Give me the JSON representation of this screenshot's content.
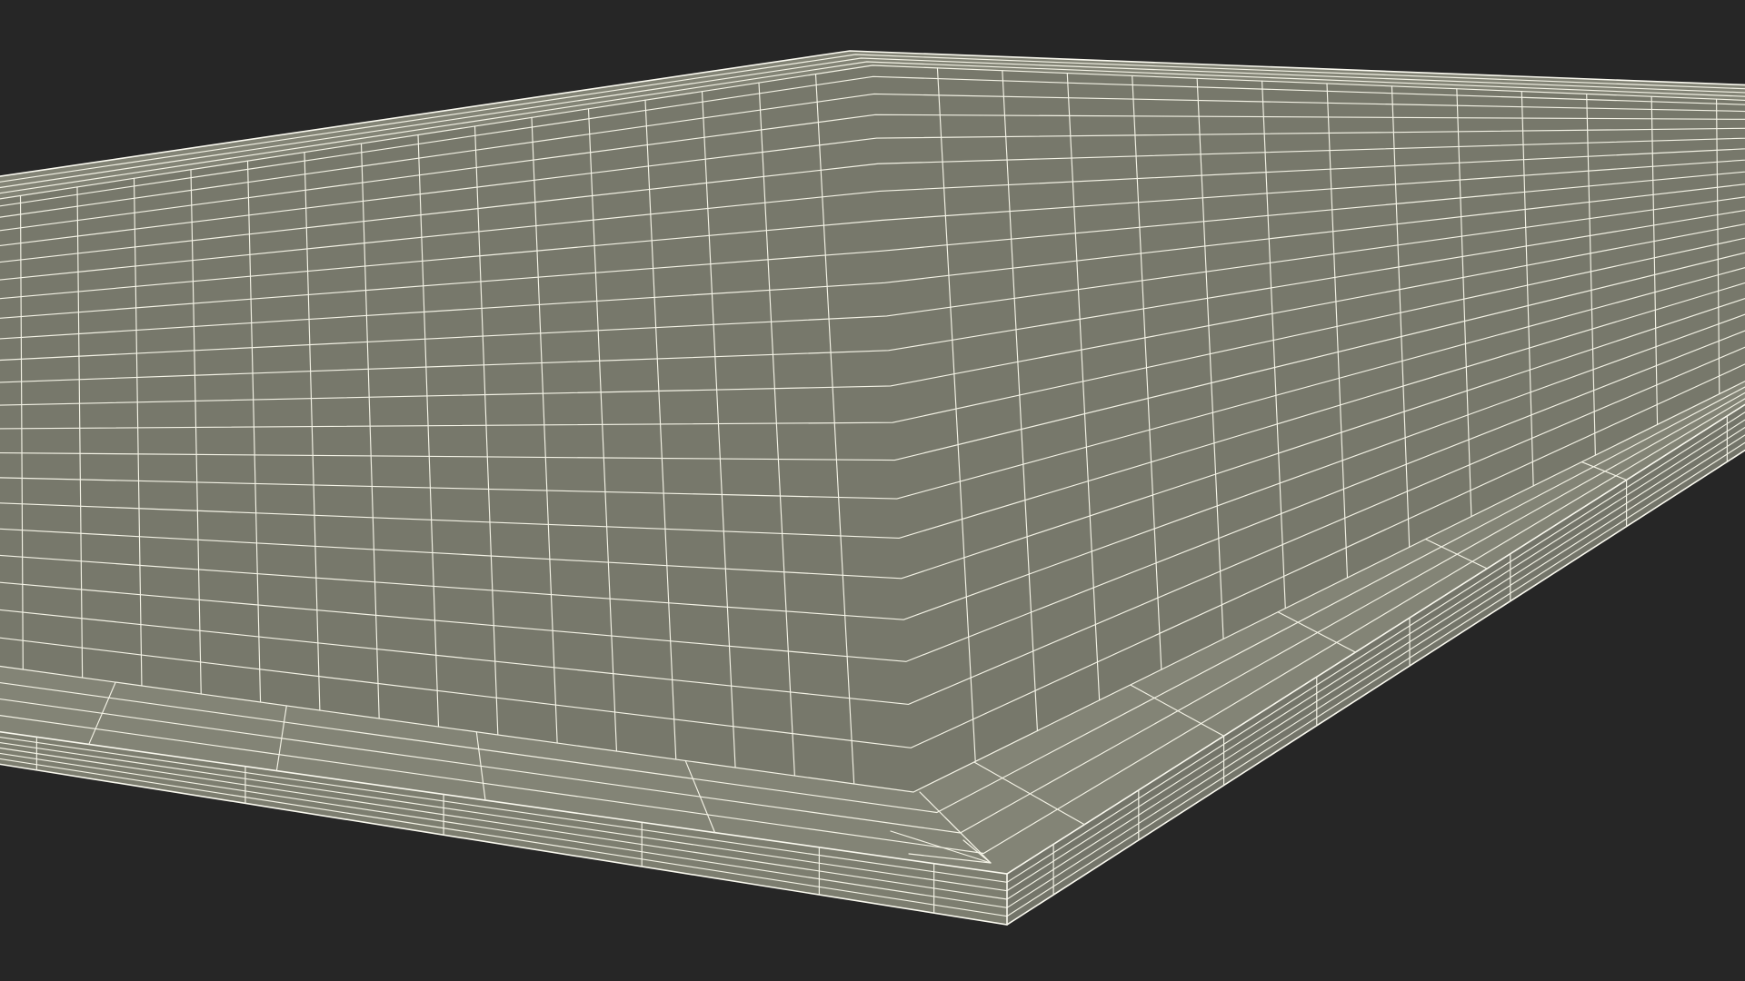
{
  "scene": {
    "subject": "wireframe-rectangular-slab",
    "background_color": "#262626",
    "top_face_color": "#77786b",
    "side_face_color": "#7d7e70",
    "wire_color": "#f4f3e6"
  }
}
